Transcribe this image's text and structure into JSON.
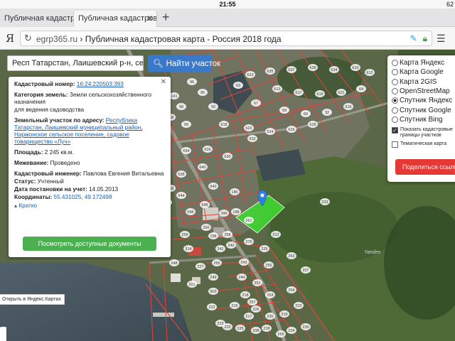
{
  "status": {
    "time": "21:55",
    "battery": "62"
  },
  "tabs": [
    {
      "label": "Публичная кадастровая"
    },
    {
      "label": "Публичная кадастров"
    }
  ],
  "address": {
    "ya": "Я",
    "host": "egrp365.ru",
    "sep": " › ",
    "title": "Публичная кадастровая карта - Россия 2018 года"
  },
  "map": {
    "search_value": "Респ Татарстан, Лаишевский р-н, село Т",
    "search_button": "Найти участок",
    "open_in_yandex": "Открыть в Яндекс.Картах",
    "watermark": "Yandex",
    "parcel_labels": [
      "63",
      "633",
      "635",
      "637",
      "639",
      "634",
      "610",
      "612",
      "613",
      "617",
      "619",
      "621",
      "64",
      "67",
      "69",
      "60",
      "32",
      "616",
      "618",
      "622",
      "624",
      "626",
      "628",
      "630",
      "632",
      "626",
      "654",
      "638",
      "640",
      "642",
      "644",
      "646",
      "648",
      "92",
      "95",
      "96",
      "98",
      "99",
      "141",
      "152",
      "158",
      "160",
      "162",
      "166",
      "168",
      "170",
      "172",
      "186",
      "188",
      "198",
      "241",
      "242",
      "243",
      "244",
      "250",
      "253",
      "903",
      "216",
      "217",
      "218",
      "219",
      "220",
      "222",
      "223",
      "225",
      "227",
      "233",
      "252",
      "254",
      "256",
      "257",
      "258",
      "259",
      "260",
      "261",
      "263",
      "337",
      "338",
      "390",
      "314",
      "248",
      "221",
      "249",
      "255",
      "270",
      "225",
      "212",
      "218",
      "226",
      "230",
      "234",
      "222",
      "230"
    ]
  },
  "popup": {
    "cad_num_label": "Кадастровый номер:",
    "cad_num": "16:24:220503:393",
    "category_label": "Категория земель:",
    "category": "Земли сельскохозяйственного назначения",
    "usage": "для ведения садоводства",
    "address_label": "Земельный участок по адресу:",
    "address": "Республика Татарстан, Лаишевский муниципальный район, Нармонское сельское поселение, садовое товарищество «Луч»",
    "area_label": "Площадь:",
    "area": "2 245 кв.м.",
    "survey_label": "Межевание:",
    "survey": "Проведено",
    "engineer_label": "Кадастровый инженер:",
    "engineer": "Павлова Евгения Витальевна",
    "status_label": "Статус:",
    "status": "Учтенный",
    "date_label": "Дата постановки на учет:",
    "date": "14.05.2013",
    "coords_label": "Координаты:",
    "coords": "55.431025, 49.172498",
    "less": "Кратко",
    "docs_button": "Посмотреть доступные документы"
  },
  "layers": {
    "items": [
      {
        "label": "Карта Яндекс",
        "selected": false
      },
      {
        "label": "Карта Google",
        "selected": false
      },
      {
        "label": "Карта 2GIS",
        "selected": false
      },
      {
        "label": "OpenStreetMap",
        "selected": false
      },
      {
        "label": "Спутник Яндекс",
        "selected": true
      },
      {
        "label": "Спутник Google",
        "selected": false
      },
      {
        "label": "Спутник Bing",
        "selected": false
      }
    ],
    "show_boundaries_1": "Показать кадастровые",
    "show_boundaries_2": "границы участков",
    "thematic": "Тематическая карта",
    "share_button": "Поделиться ссылкой"
  },
  "colors": {
    "parcel_outline": "#e0443b",
    "selected_parcel": "#3ddc2f",
    "marker": "#2f7fe0",
    "docs_button": "#4caf50",
    "share_button": "#e53935",
    "search_button": "#3a79c9"
  }
}
